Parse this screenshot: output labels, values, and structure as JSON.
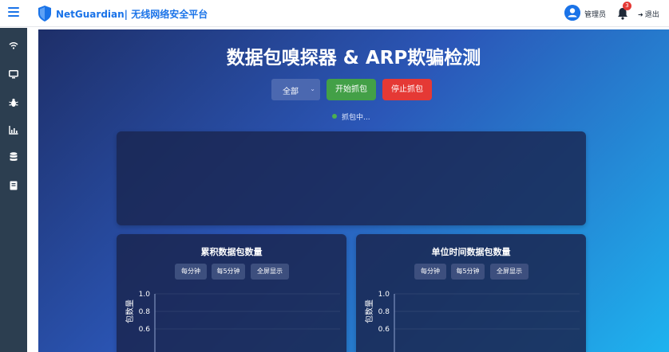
{
  "header": {
    "brand": "NetGuardian| 无线网络安全平台",
    "user_name": "管理员",
    "notification_count": "3",
    "logout_label": "退出"
  },
  "sidebar": {
    "items": [
      {
        "icon": "wifi-icon"
      },
      {
        "icon": "monitor-icon"
      },
      {
        "icon": "bug-icon"
      },
      {
        "icon": "chart-icon"
      },
      {
        "icon": "database-icon"
      },
      {
        "icon": "book-icon"
      }
    ]
  },
  "main": {
    "title": "数据包嗅探器 & ARP欺骗检测",
    "filter_select": {
      "value": "全部"
    },
    "start_button": "开始抓包",
    "stop_button": "停止抓包",
    "status_text": "抓包中..."
  },
  "charts": [
    {
      "title": "累积数据包数量",
      "buttons": [
        "每分钟",
        "每5分钟",
        "全屏显示"
      ],
      "ylabel": "包数量",
      "yticks": [
        "1.0",
        "0.8",
        "0.6"
      ]
    },
    {
      "title": "单位时间数据包数量",
      "buttons": [
        "每分钟",
        "每5分钟",
        "全屏显示"
      ],
      "ylabel": "包数量",
      "yticks": [
        "1.0",
        "0.8",
        "0.6"
      ]
    }
  ],
  "chart_data": [
    {
      "type": "line",
      "title": "累积数据包数量",
      "ylabel": "包数量",
      "series": [],
      "ylim": [
        0,
        1.0
      ],
      "yticks": [
        1.0,
        0.8,
        0.6
      ]
    },
    {
      "type": "line",
      "title": "单位时间数据包数量",
      "ylabel": "包数量",
      "series": [],
      "ylim": [
        0,
        1.0
      ],
      "yticks": [
        1.0,
        0.8,
        0.6
      ]
    }
  ],
  "colors": {
    "brand": "#1a73e8",
    "start": "#43a047",
    "stop": "#e53935",
    "status_dot": "#4caf50",
    "sidebar": "#2c3e50"
  }
}
